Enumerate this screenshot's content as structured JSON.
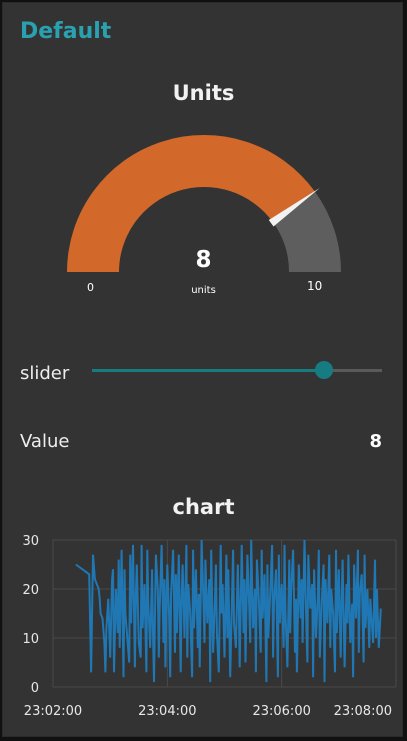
{
  "group": {
    "title": "Default"
  },
  "gauge": {
    "title": "Units",
    "value": "8",
    "units": "units",
    "min_label": "0",
    "max_label": "10",
    "value_fraction": 0.8,
    "fill_color": "#d2692a",
    "remainder_color": "#5e5e5e",
    "needle_color": "#f2f2f2"
  },
  "slider": {
    "label": "slider",
    "value_fraction": 0.8,
    "accent_color": "#167c82"
  },
  "value_display": {
    "label": "Value",
    "value": "8"
  },
  "chart": {
    "title": "chart",
    "y_tick_labels": [
      "30",
      "20",
      "10",
      "0"
    ],
    "x_tick_labels": [
      "23:02:00",
      "23:04:00",
      "23:06:00",
      "23:08:00"
    ]
  },
  "chart_data": {
    "type": "line",
    "title": "chart",
    "xlabel": "",
    "ylabel": "",
    "ylim": [
      0,
      30
    ],
    "xlim": [
      "23:02:00",
      "23:08:00"
    ],
    "grid": true,
    "series_color": "#1f78b4",
    "x_seconds_from_start": [
      24,
      38,
      40,
      42,
      44,
      48,
      49,
      50,
      52,
      54,
      55,
      56,
      58,
      60,
      62,
      63,
      64,
      66,
      68,
      69,
      70,
      72,
      74,
      75,
      76,
      78,
      80,
      81,
      82,
      84,
      86,
      87,
      88,
      90,
      92,
      93,
      94,
      96,
      98,
      99,
      100,
      102,
      104,
      105,
      106,
      108,
      110,
      111,
      112,
      114,
      116,
      117,
      118,
      120,
      122,
      123,
      124,
      126,
      128,
      129,
      130,
      132,
      134,
      135,
      136,
      138,
      140,
      141,
      142,
      144,
      146,
      147,
      148,
      150,
      152,
      153,
      154,
      156,
      158,
      159,
      160,
      162,
      164,
      165,
      166,
      168,
      170,
      171,
      172,
      174,
      176,
      177,
      178,
      180,
      182,
      183,
      184,
      186,
      188,
      189,
      190,
      192,
      194,
      195,
      196,
      198,
      200,
      201,
      202,
      204,
      206,
      207,
      208,
      210,
      212,
      213,
      214,
      216,
      218,
      219,
      220,
      222,
      224,
      225,
      226,
      228,
      230,
      231,
      232,
      234,
      236,
      237,
      238,
      240,
      242,
      243,
      244,
      246,
      248,
      249,
      250,
      252,
      254,
      255,
      256,
      258,
      260,
      261,
      262,
      264,
      266,
      267,
      268,
      270,
      272,
      273,
      274,
      276,
      278,
      279,
      280,
      282,
      284,
      285,
      286,
      288,
      290,
      291,
      292,
      294,
      296,
      297,
      298,
      300,
      302,
      303,
      304,
      306,
      308,
      309,
      310,
      312,
      314,
      315,
      316,
      318,
      320,
      321,
      322,
      324,
      326,
      327,
      328,
      330,
      332,
      333,
      334,
      336,
      338,
      339,
      340,
      342,
      344,
      345
    ],
    "values": [
      25,
      23,
      3,
      27,
      22,
      20,
      18,
      15,
      14,
      9,
      3,
      12,
      18,
      6,
      22,
      24,
      3,
      20,
      11,
      26,
      8,
      28,
      2,
      24,
      15,
      10,
      5,
      27,
      13,
      29,
      4,
      19,
      25,
      9,
      6,
      29,
      12,
      21,
      3,
      28,
      17,
      8,
      24,
      11,
      1,
      27,
      20,
      6,
      16,
      29,
      9,
      22,
      4,
      25,
      14,
      2,
      19,
      28,
      7,
      23,
      11,
      27,
      3,
      18,
      25,
      10,
      29,
      6,
      21,
      15,
      2,
      28,
      12,
      24,
      8,
      19,
      4,
      30,
      17,
      9,
      26,
      13,
      22,
      1,
      28,
      7,
      18,
      25,
      11,
      3,
      29,
      15,
      21,
      6,
      27,
      10,
      24,
      2,
      19,
      28,
      13,
      8,
      25,
      17,
      4,
      29,
      11,
      22,
      5,
      27,
      16,
      9,
      30,
      12,
      20,
      3,
      26,
      18,
      7,
      28,
      14,
      23,
      1,
      25,
      10,
      19,
      29,
      6,
      17,
      24,
      2,
      27,
      13,
      21,
      8,
      29,
      15,
      4,
      26,
      11,
      20,
      28,
      7,
      18,
      3,
      25,
      14,
      22,
      9,
      30,
      12,
      5,
      27,
      16,
      21,
      2,
      24,
      10,
      19,
      28,
      6,
      17,
      25,
      1,
      22,
      13,
      27,
      8,
      20,
      15,
      3,
      28,
      11,
      24,
      6,
      18,
      26,
      4,
      21,
      13,
      27,
      9,
      17,
      2,
      25,
      14,
      28,
      7,
      19,
      23,
      5,
      27,
      12,
      20,
      8,
      18,
      15,
      9,
      26,
      10,
      20,
      8,
      16
    ]
  }
}
